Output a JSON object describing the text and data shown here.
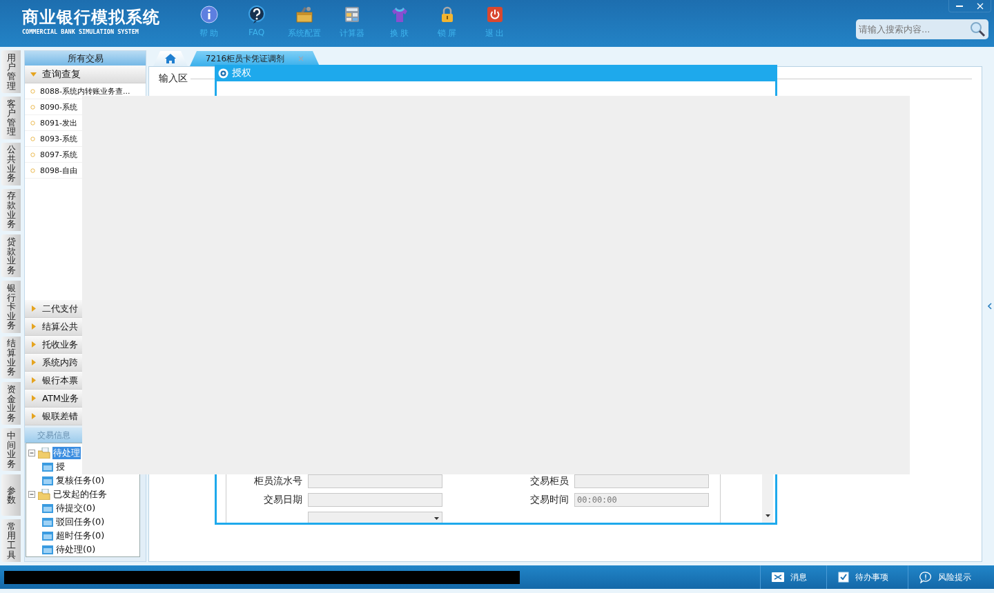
{
  "header": {
    "title": "商业银行模拟系统",
    "subtitle": "COMMERCIAL BANK SIMULATION SYSTEM",
    "toolbar": [
      {
        "kind": "info",
        "label": "帮 助"
      },
      {
        "kind": "faq",
        "label": "FAQ"
      },
      {
        "kind": "config",
        "label": "系统配置"
      },
      {
        "kind": "calc",
        "label": "计算器"
      },
      {
        "kind": "skin",
        "label": "换 肤"
      },
      {
        "kind": "lock",
        "label": "锁 屏"
      },
      {
        "kind": "exit",
        "label": "退 出"
      }
    ],
    "search": {
      "placeholder": "请输入搜索内容..."
    }
  },
  "side_tabs": [
    "用户管理",
    "客户管理",
    "公共业务",
    "存款业务",
    "贷款业务",
    "银行卡业务",
    "结算业务",
    "资金业务",
    "中间业务",
    "参数",
    "常用工具"
  ],
  "sidebar": {
    "title": "所有交易",
    "groups": [
      {
        "label": "查询查复",
        "expanded": true,
        "items": [
          "8088-系统内转账业务查...",
          "8090-系统",
          "8091-发出",
          "8093-系统",
          "8097-系统",
          "8098-自由"
        ]
      },
      {
        "label": "二代支付",
        "expanded": false
      },
      {
        "label": "结算公共",
        "expanded": false
      },
      {
        "label": "托收业务",
        "expanded": false
      },
      {
        "label": "系统内跨",
        "expanded": false
      },
      {
        "label": "银行本票",
        "expanded": false
      },
      {
        "label": "ATM业务",
        "expanded": false
      },
      {
        "label": "银联差错",
        "expanded": false
      }
    ],
    "info_title": "交易信息",
    "tree": [
      {
        "label": "待处理",
        "selected": true,
        "expanded": true,
        "children": [
          {
            "label": "授",
            "selected": false
          },
          {
            "label": "复核任务(0)",
            "selected": false
          }
        ]
      },
      {
        "label": "已发起的任务",
        "selected": false,
        "expanded": true,
        "children": [
          {
            "label": "待提交(0)",
            "selected": false
          },
          {
            "label": "驳回任务(0)",
            "selected": false
          },
          {
            "label": "超时任务(0)",
            "selected": false
          },
          {
            "label": "待处理(0)",
            "selected": false
          }
        ]
      }
    ]
  },
  "tabs": [
    {
      "kind": "home",
      "selected": false
    },
    {
      "kind": "page",
      "label": "7216柜员卡凭证调剂",
      "selected": true
    }
  ],
  "input_area": {
    "title": "输入区"
  },
  "dialog": {
    "title": "授权",
    "fields": [
      {
        "kind": "text",
        "label": "柜员流水号",
        "disabled": true
      },
      {
        "kind": "text",
        "label": "交易柜员",
        "disabled": true
      },
      {
        "kind": "text",
        "label": "交易日期",
        "disabled": true
      },
      {
        "kind": "text",
        "label": "交易时间",
        "value": "00:00:00",
        "disabled": true
      },
      {
        "kind": "select",
        "disabled": true
      }
    ]
  },
  "status_bar": {
    "items": [
      {
        "kind": "message",
        "label": "消息"
      },
      {
        "kind": "todo",
        "label": "待办事项"
      },
      {
        "kind": "risk",
        "label": "风险提示"
      }
    ]
  }
}
